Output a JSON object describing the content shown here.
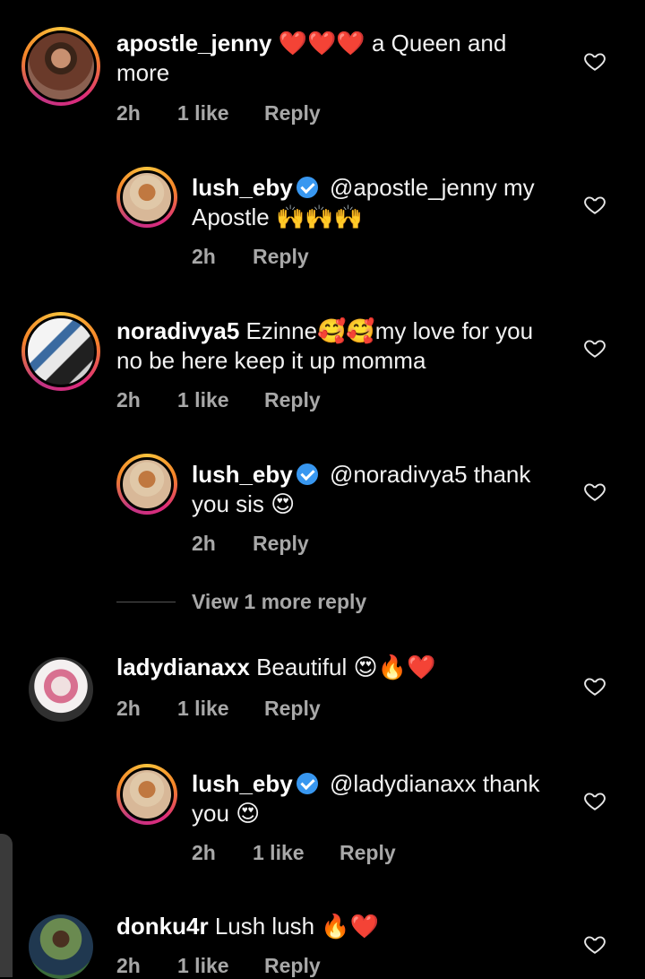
{
  "colors": {
    "background": "#000000",
    "text": "#f5f5f5",
    "meta": "#a8a8a8",
    "verified": "#3897f0"
  },
  "comments": [
    {
      "username": "apostle_jenny",
      "text": "❤️❤️❤️ a Queen and more",
      "time": "2h",
      "likes": "1 like",
      "reply": "Reply"
    },
    {
      "username": "lush_eby",
      "text": "@apostle_jenny my Apostle 🙌🙌🙌",
      "time": "2h",
      "reply": "Reply"
    },
    {
      "username": "noradivya5",
      "text": "Ezinne🥰🥰my love for you no be here keep it up momma",
      "time": "2h",
      "likes": "1 like",
      "reply": "Reply"
    },
    {
      "username": "lush_eby",
      "text": "@noradivya5 thank you sis 😍",
      "time": "2h",
      "reply": "Reply"
    },
    {
      "username": "ladydianaxx",
      "text": "Beautiful 😍🔥❤️",
      "time": "2h",
      "likes": "1 like",
      "reply": "Reply"
    },
    {
      "username": "lush_eby",
      "text": "@ladydianaxx thank you 😍",
      "time": "2h",
      "likes": "1 like",
      "reply": "Reply"
    },
    {
      "username": "donku4r",
      "text": "Lush lush 🔥❤️",
      "time": "2h",
      "likes": "1 like",
      "reply": "Reply"
    }
  ],
  "view_more": "View 1 more reply",
  "icons": {
    "like": "heart-outline-icon",
    "verified": "verified-badge-icon"
  }
}
